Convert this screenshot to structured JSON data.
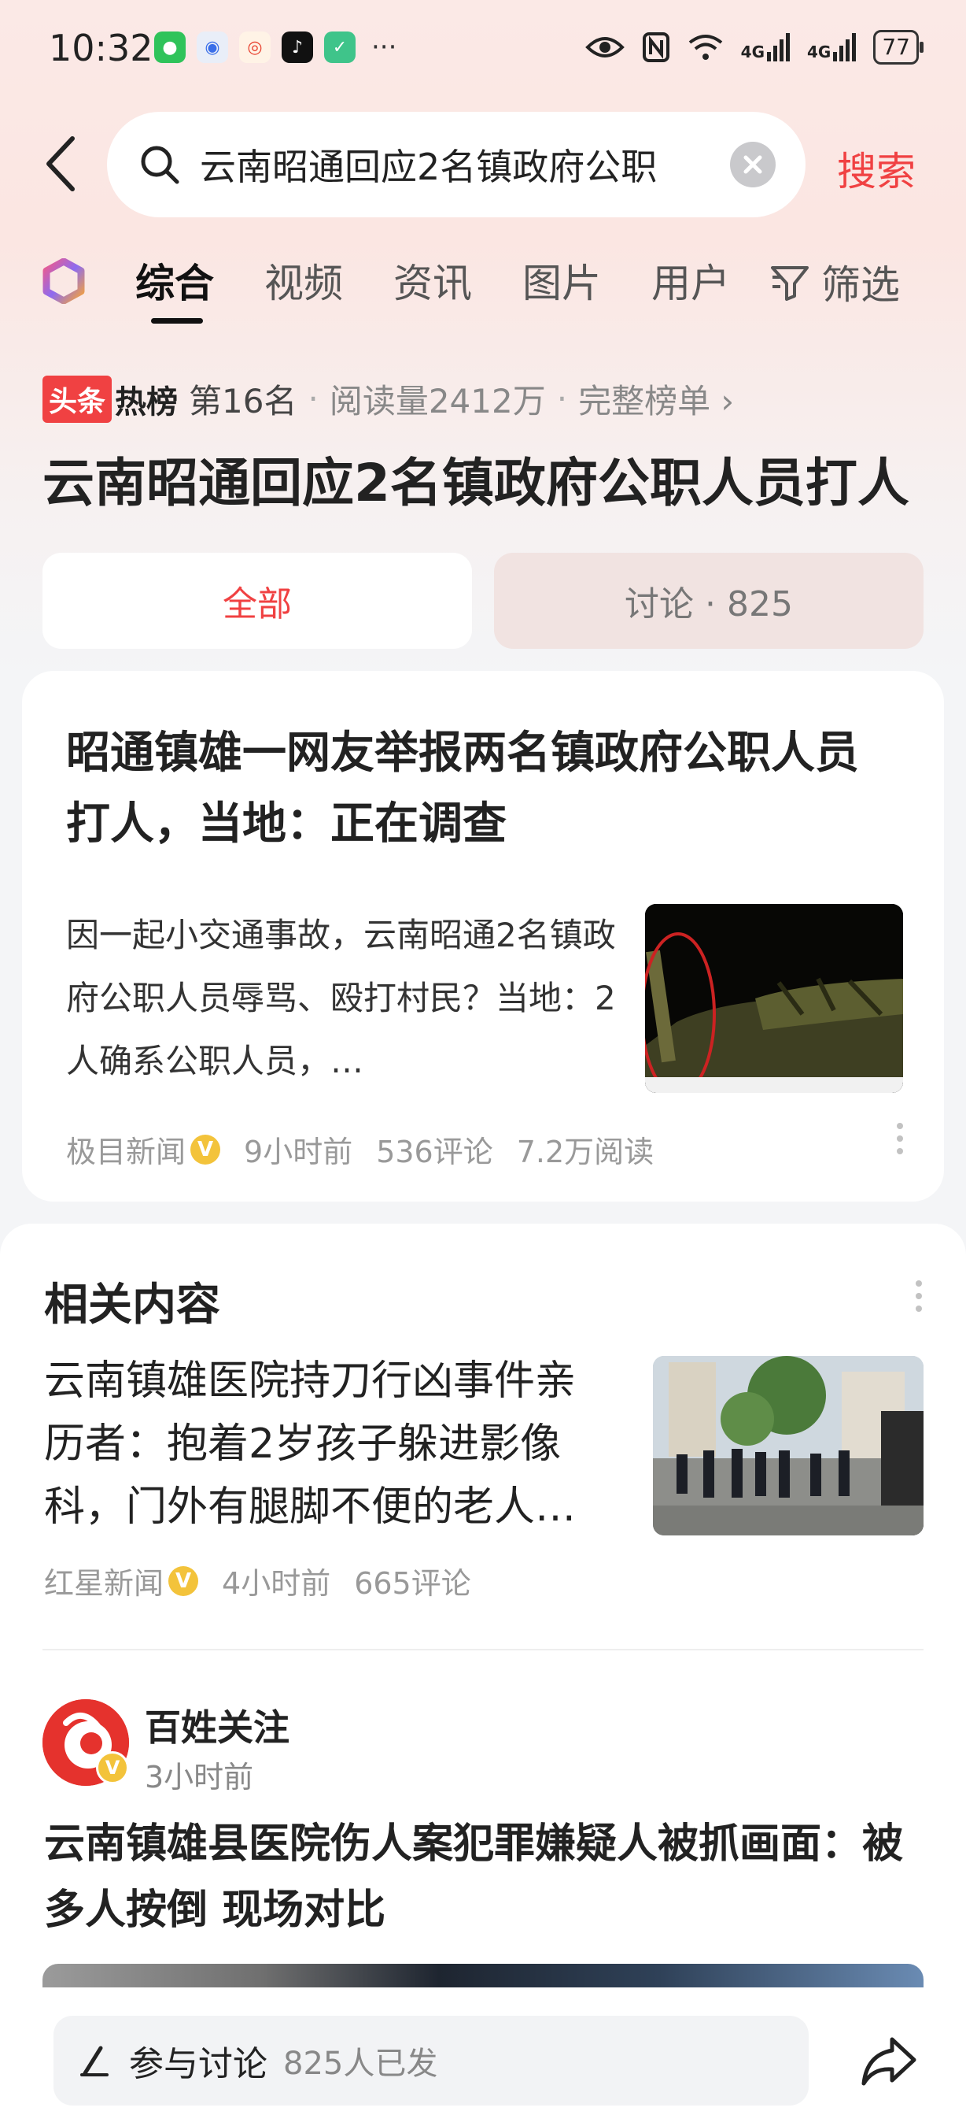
{
  "status_bar": {
    "time": "10:32",
    "network_1": "4G",
    "network_2": "4G",
    "battery": "77",
    "more": "···",
    "app_icons": [
      "wechat-icon",
      "qq-browser-icon",
      "weibo-icon",
      "tiktok-icon",
      "shield-app-icon"
    ]
  },
  "search": {
    "query": "云南昭通回应2名镇政府公职",
    "submit_label": "搜索"
  },
  "tabs": [
    {
      "label": "综合",
      "active": true
    },
    {
      "label": "视频",
      "active": false
    },
    {
      "label": "资讯",
      "active": false
    },
    {
      "label": "图片",
      "active": false
    },
    {
      "label": "用户",
      "active": false
    }
  ],
  "filter_label": "筛选",
  "hot": {
    "badge_left": "头条",
    "badge_right": "热榜",
    "rank": "第16名",
    "reads": "阅读量2412万",
    "full_list": "完整榜单 ›"
  },
  "topic_title": "云南昭通回应2名镇政府公职人员打人",
  "segments": {
    "all": "全部",
    "discuss": "讨论 · 825"
  },
  "featured": {
    "title": "昭通镇雄一网友举报两名镇政府公职人员打人，当地：正在调查",
    "summary": "因一起小交通事故，云南昭通2名镇政府公职人员辱骂、殴打村民？当地：2人确系公职人员，…",
    "source": "极目新闻",
    "time": "9小时前",
    "comments": "536评论",
    "reads": "7.2万阅读"
  },
  "related": {
    "heading": "相关内容",
    "item_title": "云南镇雄医院持刀行凶事件亲历者：抱着2岁孩子躲进影像科，门外有腿脚不便的老人…",
    "source": "红星新闻",
    "time": "4小时前",
    "comments": "665评论"
  },
  "post": {
    "author": "百姓关注",
    "time": "3小时前",
    "title": "云南镇雄县医院伤人案犯罪嫌疑人被抓画面：被多人按倒 现场对比"
  },
  "bottom": {
    "comment_label": "参与讨论",
    "comment_count": "825人已发"
  },
  "verify_mark": "V",
  "colors": {
    "accent": "#f04142",
    "verify": "#f3c33b"
  }
}
